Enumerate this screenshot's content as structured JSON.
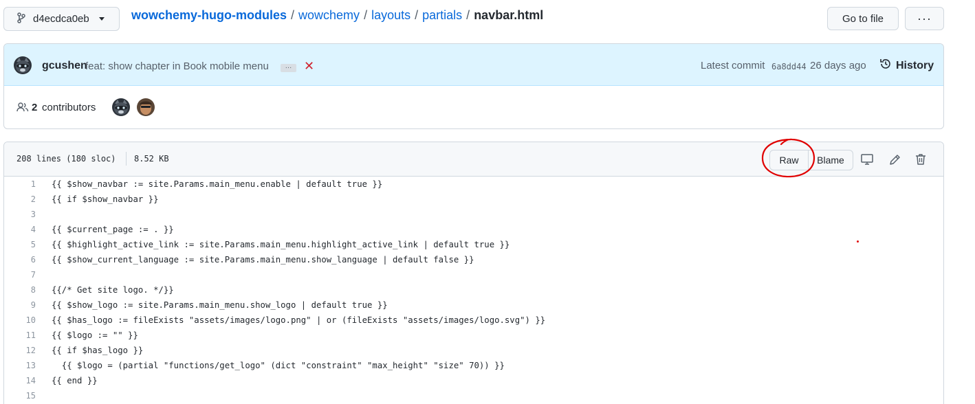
{
  "branch": {
    "label": "d4ecdca0eb"
  },
  "breadcrumb": {
    "repo": "wowchemy-hugo-modules",
    "parts": [
      "wowchemy",
      "layouts",
      "partials"
    ],
    "separator": "/",
    "current": "navbar.html"
  },
  "actions": {
    "go_to_file": "Go to file",
    "more": "···"
  },
  "commit": {
    "author": "gcushen",
    "message": "feat: show chapter in Book mobile menu",
    "ellipsis": "…",
    "status_icon": "✕",
    "latest_label": "Latest commit",
    "sha": "6a8dd44",
    "age": "26 days ago",
    "history_label": "History"
  },
  "contributors": {
    "count": "2",
    "label": "contributors"
  },
  "file": {
    "lines_info": "208 lines (180 sloc)",
    "size": "8.52 KB",
    "raw_label": "Raw",
    "blame_label": "Blame"
  },
  "code": [
    {
      "n": "1",
      "text": "{{ $show_navbar := site.Params.main_menu.enable | default true }}"
    },
    {
      "n": "2",
      "text": "{{ if $show_navbar }}"
    },
    {
      "n": "3",
      "text": ""
    },
    {
      "n": "4",
      "text": "{{ $current_page := . }}"
    },
    {
      "n": "5",
      "text": "{{ $highlight_active_link := site.Params.main_menu.highlight_active_link | default true }}"
    },
    {
      "n": "6",
      "text": "{{ $show_current_language := site.Params.main_menu.show_language | default false }}"
    },
    {
      "n": "7",
      "text": ""
    },
    {
      "n": "8",
      "text": "{{/* Get site logo. */}}"
    },
    {
      "n": "9",
      "text": "{{ $show_logo := site.Params.main_menu.show_logo | default true }}"
    },
    {
      "n": "10",
      "text": "{{ $has_logo := fileExists \"assets/images/logo.png\" | or (fileExists \"assets/images/logo.svg\") }}"
    },
    {
      "n": "11",
      "text": "{{ $logo := \"\" }}"
    },
    {
      "n": "12",
      "text": "{{ if $has_logo }}"
    },
    {
      "n": "13",
      "text": "  {{ $logo = (partial \"functions/get_logo\" (dict \"constraint\" \"max_height\" \"size\" 70)) }}"
    },
    {
      "n": "14",
      "text": "{{ end }}"
    },
    {
      "n": "15",
      "text": ""
    }
  ],
  "colors": {
    "link": "#0969da",
    "commit_bg": "#ddf4ff",
    "annotation": "#e00000"
  }
}
